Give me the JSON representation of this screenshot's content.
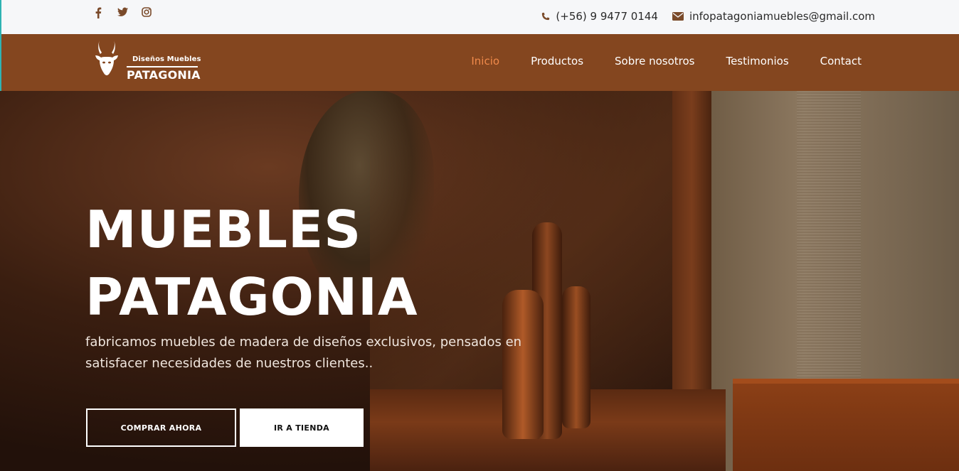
{
  "topbar": {
    "social": [
      "facebook-icon",
      "twitter-icon",
      "instagram-icon"
    ],
    "phone": "(+56) 9 9477 0144",
    "email": "infopatagoniamuebles@gmail.com"
  },
  "brand": {
    "small": "Diseños Muebles",
    "big": "PATAGONIA"
  },
  "nav": {
    "items": [
      "Inicio",
      "Productos",
      "Sobre nosotros",
      "Testimonios",
      "Contact"
    ],
    "active": "Inicio"
  },
  "hero": {
    "title_line1": "MUEBLES",
    "title_line2": "PATAGONIA",
    "subtitle": "fabricamos muebles de madera de diseños exclusivos, pensados en satisfacer necesidades de nuestros clientes..",
    "buttons": {
      "primary": "COMPRAR AHORA",
      "secondary": "IR A TIENDA"
    }
  },
  "colors": {
    "nav_bg": "#84461f",
    "active_link": "#f08a4b",
    "icon_brown": "#7a4a2a"
  }
}
